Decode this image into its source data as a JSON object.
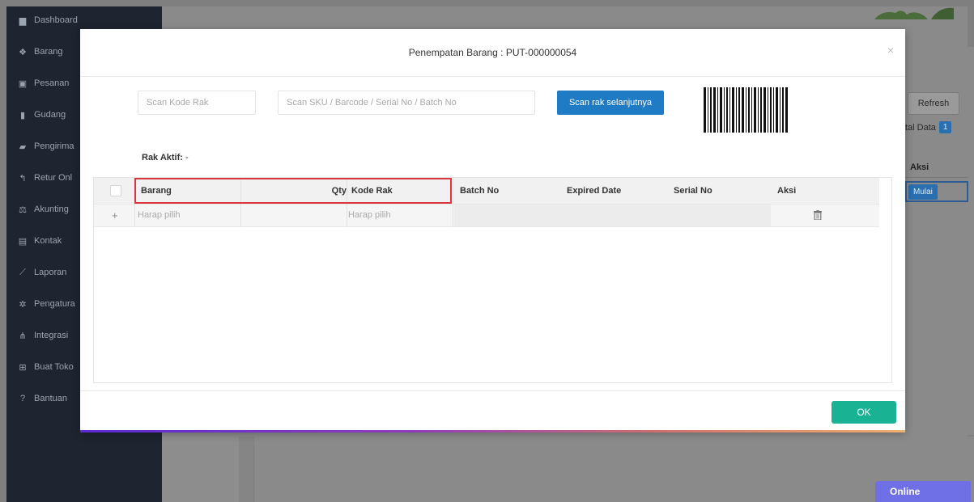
{
  "sidebar": {
    "items": [
      {
        "label": "Dashboard",
        "icon": "chart-icon"
      },
      {
        "label": "Barang",
        "icon": "cubes-icon"
      },
      {
        "label": "Pesanan",
        "icon": "gift-icon"
      },
      {
        "label": "Gudang",
        "icon": "building-icon"
      },
      {
        "label": "Pengirima",
        "icon": "truck-icon"
      },
      {
        "label": "Retur Onl",
        "icon": "reply-icon"
      },
      {
        "label": "Akunting",
        "icon": "balance-icon"
      },
      {
        "label": "Kontak",
        "icon": "contact-card-icon"
      },
      {
        "label": "Laporan",
        "icon": "line-chart-icon"
      },
      {
        "label": "Pengatura",
        "icon": "gears-icon"
      },
      {
        "label": "Integrasi",
        "icon": "sitemap-icon"
      },
      {
        "label": "Buat Toko",
        "icon": "cart-icon"
      },
      {
        "label": "Bantuan",
        "icon": "question-circle-icon"
      }
    ]
  },
  "background": {
    "refresh_label": "Refresh",
    "total_data_label": "tal Data",
    "total_data_count": "1",
    "aksi_label": "Aksi",
    "mulai_label": "Mulai",
    "online_label": "Online"
  },
  "modal": {
    "title": "Penempatan Barang : PUT-000000054",
    "close_symbol": "×",
    "scan_kode_rak_placeholder": "Scan Kode Rak",
    "scan_sku_placeholder": "Scan SKU / Barcode / Serial No / Batch No",
    "scan_next_button": "Scan rak selanjutnya",
    "rak_aktif_label": "Rak Aktif:",
    "rak_aktif_value": "-",
    "table": {
      "headers": {
        "barang": "Barang",
        "qty": "Qty",
        "kode_rak": "Kode Rak",
        "batch_no": "Batch No",
        "expired_date": "Expired Date",
        "serial_no": "Serial No",
        "aksi": "Aksi"
      },
      "row": {
        "add_symbol": "+",
        "barang": "Harap pilih",
        "kode_rak": "Harap pilih"
      }
    },
    "ok_button": "OK"
  },
  "colors": {
    "primary_blue": "#1f7bc4",
    "ok_green": "#19b394",
    "highlight_red": "#d9363e",
    "sidebar_dark": "#1e2530",
    "online_purple": "#6f6fe6"
  }
}
